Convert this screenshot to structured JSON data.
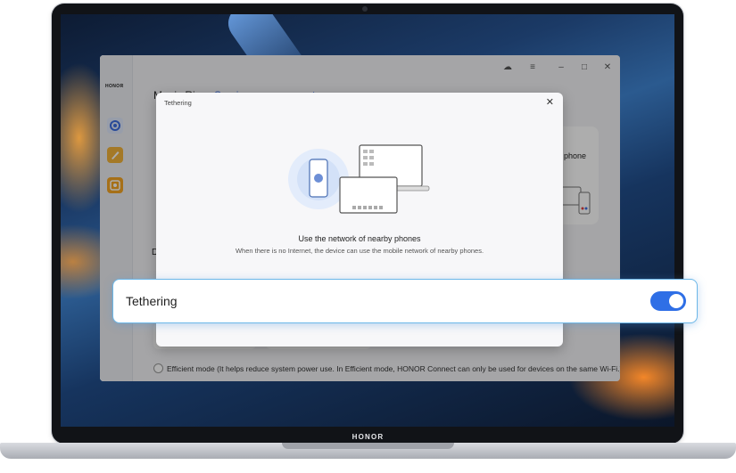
{
  "laptop": {
    "brand": "HONOR"
  },
  "app": {
    "sidebar_logo": "HONOR",
    "heading_partial": "Magic Ring",
    "heading_link_partial": "Service management",
    "device_card_text": "phone",
    "section_letter": "D",
    "efficient_mode_text": "Efficient mode (It helps reduce system power use. In Efficient mode, HONOR Connect can only be used for devices on the same Wi-Fi.)",
    "titlebar_icons": [
      "cloud-icon",
      "menu-icon",
      "minimize-icon",
      "maximize-icon",
      "close-icon"
    ]
  },
  "dialog": {
    "title": "Tethering",
    "close_glyph": "✕",
    "heading": "Use the network of nearby phones",
    "subtext": "When there is no Internet, the device can use the mobile network of nearby phones."
  },
  "tethering_bar": {
    "label": "Tethering",
    "enabled": true,
    "accent": "#2f6fe6",
    "border": "#6cb7e8"
  }
}
